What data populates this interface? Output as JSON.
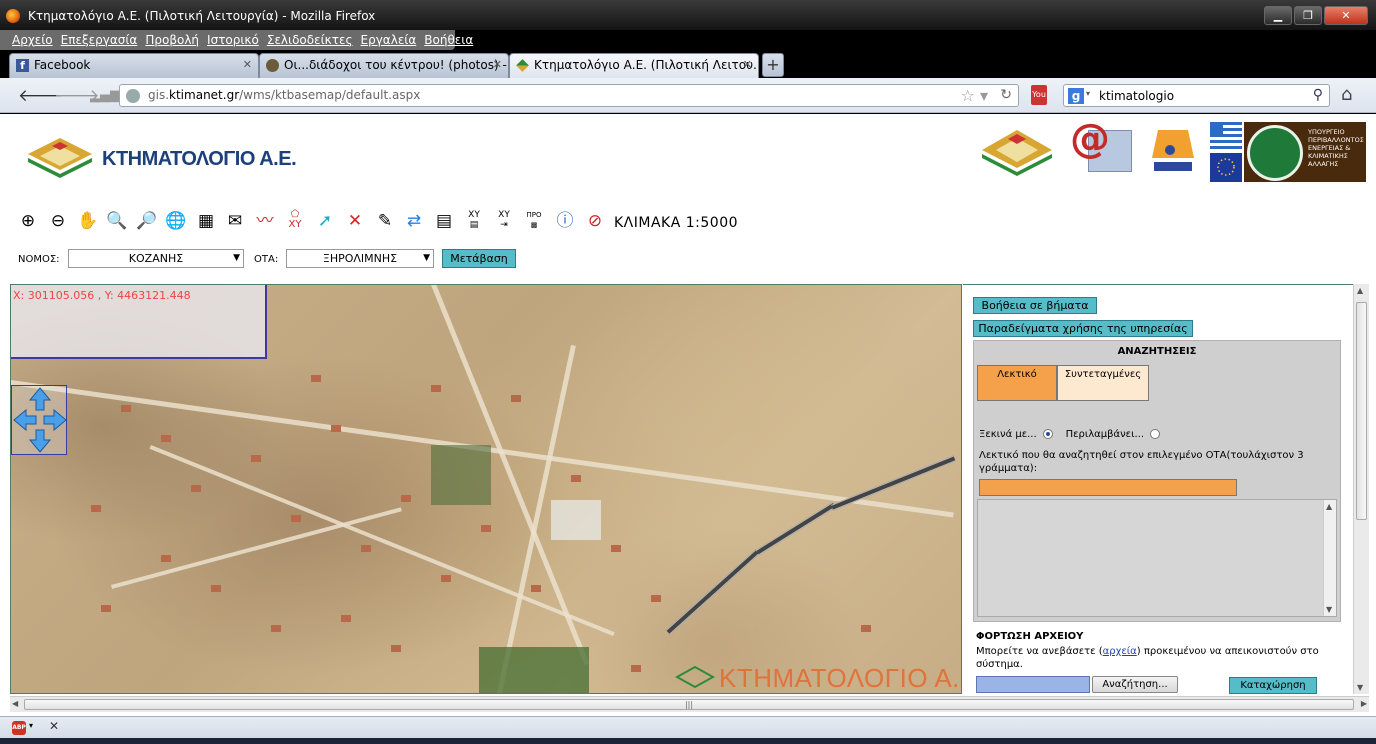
{
  "window": {
    "title": "Κτηματολόγιο Α.Ε. (Πιλοτική Λειτουργία) - Mozilla Firefox"
  },
  "menu": [
    "Αρχείο",
    "Επεξεργασία",
    "Προβολή",
    "Ιστορικό",
    "Σελιδοδείκτες",
    "Εργαλεία",
    "Βοήθεια"
  ],
  "tabs": [
    {
      "label": "Facebook",
      "icon": "facebook-icon"
    },
    {
      "label": "Οι...διάδοχοι του κέντρου! (photos) -...",
      "icon": "owl-icon"
    },
    {
      "label": "Κτηματολόγιο Α.Ε. (Πιλοτική Λειτου...",
      "icon": "ktimatologio-icon",
      "active": true
    }
  ],
  "nav": {
    "url_prefix": "gis.",
    "url_domain": "ktimanet.gr",
    "url_path": "/wms/ktbasemap/default.aspx",
    "search_query": "ktimatologio"
  },
  "header": {
    "logo_text": "ΚΤΗΜΑΤΟΛΟΓΙΟ Α.Ε.",
    "ministry_text": "ΥΠΟΥΡΓΕΙΟ ΠΕΡΙΒΑΛΛΟΝΤΟΣ ΕΝΕΡΓΕΙΑΣ & ΚΛΙΜΑΤΙΚΗΣ ΑΛΛΑΓΗΣ"
  },
  "toolbar": {
    "scale": "ΚΛΙΜΑΚΑ 1:5000",
    "xy_label": "XY",
    "pro_label": "ΠΡΟ"
  },
  "filters": {
    "nomos_label": "ΝΟΜΟΣ:",
    "nomos_value": "ΚΟΖΑΝΗΣ",
    "ota_label": "ΟΤΑ:",
    "ota_value": "ΞΗΡΟΛΙΜΝΗΣ",
    "go_label": "Μετάβαση"
  },
  "map": {
    "coords": "X: 301105.056 , Y: 4463121.448",
    "watermark": "ΚΤΗΜΑΤΟΛΟΓΙΟ Α.Ε"
  },
  "side": {
    "help_label": "Βοήθεια σε βήματα",
    "examples_label": "Παραδείγματα χρήσης της υπηρεσίας",
    "search_title": "ΑΝΑΖΗΤΗΣΕΙΣ",
    "tab_text": "Λεκτικό",
    "tab_coords": "Συντεταγμένες",
    "starts_with": "Ξεκινά με...",
    "contains": "Περιλαμβάνει...",
    "hint": "Λεκτικό που θα αναζητηθεί στον επιλεγμένο ΟΤΑ(τουλάχιστον 3 γράμματα):",
    "upload_title": "ΦΟΡΤΩΣΗ ΑΡΧΕΙΟΥ",
    "upload_pre": "Μπορείτε να ανεβάσετε (",
    "upload_link": "αρχεία",
    "upload_post": ") προκειμένου να απεικονιστούν στο σύστημα.",
    "browse_label": "Αναζήτηση...",
    "submit_label": "Καταχώρηση"
  },
  "colors": {
    "accent_teal": "#56bcc7",
    "accent_orange": "#f5a04a",
    "logo_blue": "#1d3f7a"
  }
}
